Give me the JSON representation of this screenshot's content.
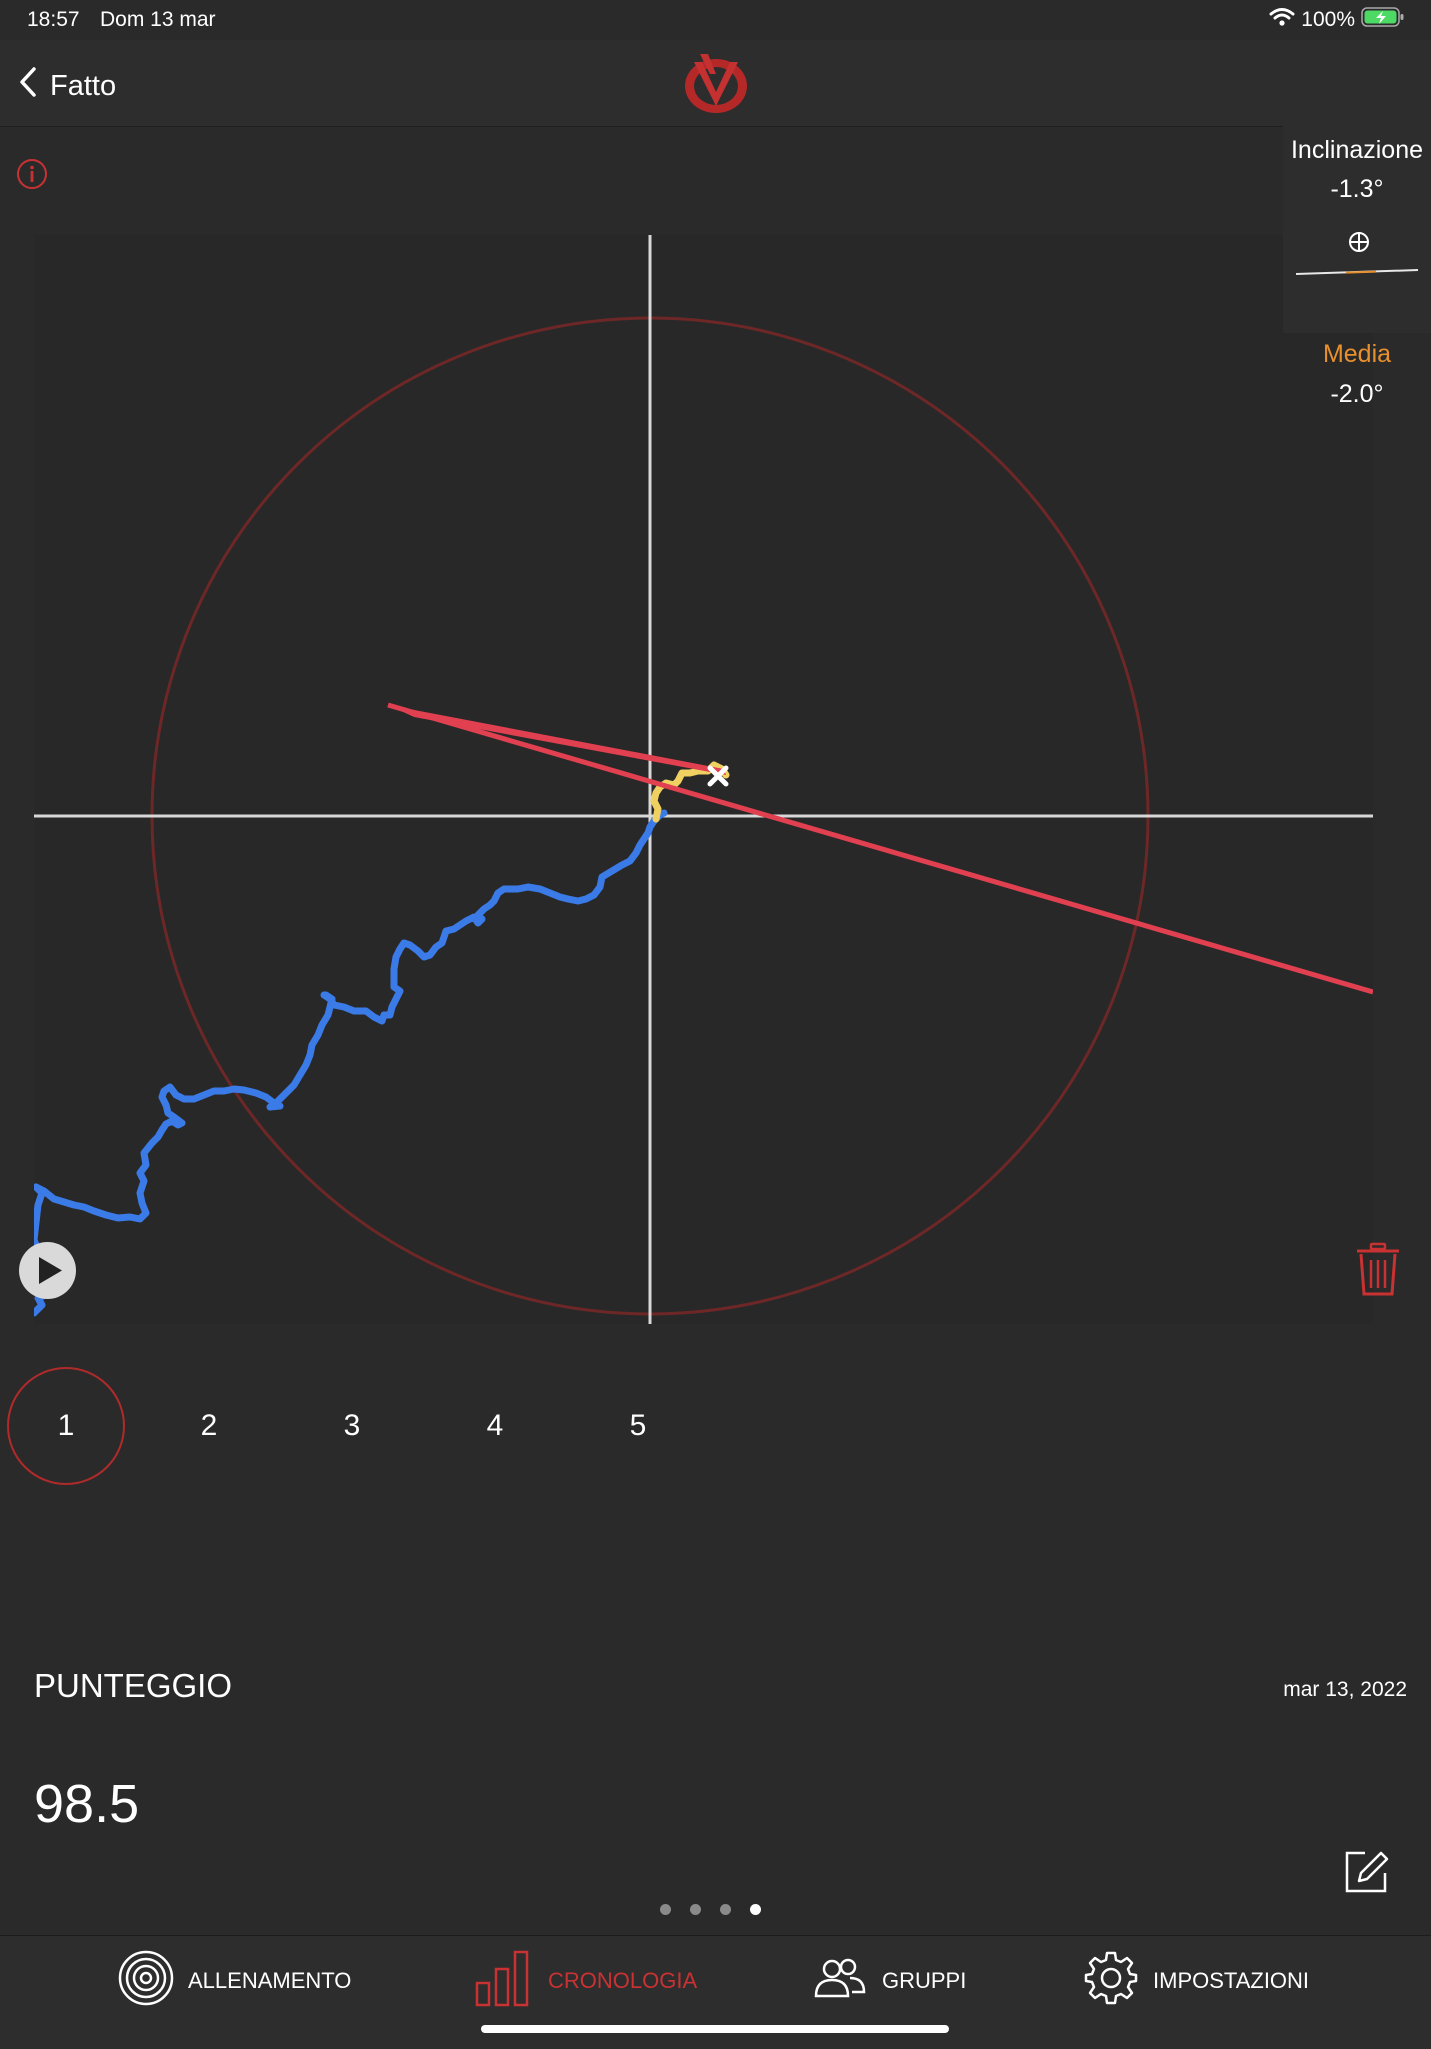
{
  "status_bar": {
    "time": "18:57",
    "date": "Dom 13 mar",
    "battery": "100%"
  },
  "nav": {
    "back_label": "Fatto"
  },
  "inclination": {
    "label": "Inclinazione",
    "value": "-1.3°",
    "average_label": "Media",
    "average_value": "-2.0°"
  },
  "shots": {
    "items": [
      "1",
      "2",
      "3",
      "4",
      "5"
    ],
    "selected": "1"
  },
  "score": {
    "label": "PUNTEGGIO",
    "date": "mar 13, 2022",
    "value": "98.5"
  },
  "pager": {
    "total": 4,
    "active": 4
  },
  "tabs": [
    {
      "label": "ALLENAMENTO",
      "icon": "target-icon"
    },
    {
      "label": "CRONOLOGIA",
      "icon": "bar-chart-icon",
      "active": true
    },
    {
      "label": "GRUPPI",
      "icon": "people-icon"
    },
    {
      "label": "IMPOSTAZIONI",
      "icon": "gear-icon"
    }
  ],
  "colors": {
    "accent_red": "#c83232",
    "trace_blue": "#3b7be8",
    "trace_yellow": "#f0d060",
    "average_orange": "#e8902e",
    "battery_green": "#4cd964"
  }
}
